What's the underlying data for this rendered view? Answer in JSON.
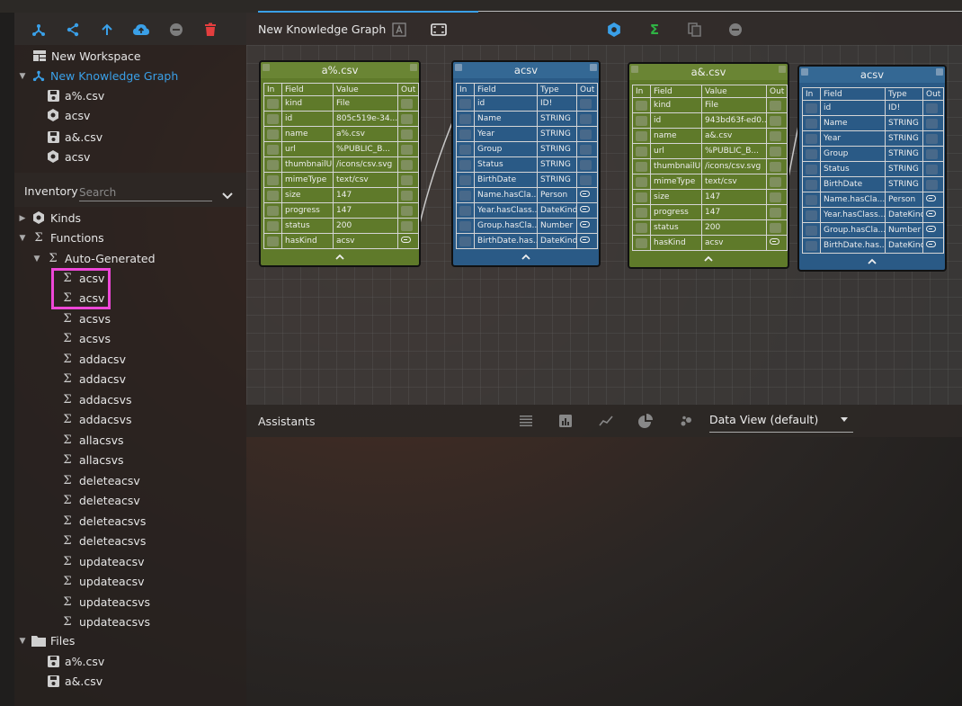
{
  "window": {
    "title": "New Knowledge Graph"
  },
  "colors": {
    "accent": "#3aa0e8",
    "highlight": "#ee47d8",
    "danger": "#e33e3e",
    "green": "#2fb344",
    "node_green": "#5f7a2a",
    "node_blue": "#2a5a86"
  },
  "toolbar": {
    "icons": [
      "graph-icon",
      "share-icon",
      "upload-arrow-icon",
      "cloud-upload-icon",
      "minus-circle-icon",
      "trash-icon"
    ]
  },
  "workspace": {
    "label": "New Workspace",
    "graph": {
      "label": "New Knowledge Graph",
      "children": [
        "a%.csv",
        "acsv",
        "a&.csv",
        "acsv"
      ]
    }
  },
  "inventory": {
    "label": "Inventory",
    "search_placeholder": "Search",
    "kinds_label": "Kinds",
    "functions_label": "Functions",
    "auto_generated_label": "Auto-Generated",
    "functions": [
      "acsv",
      "acsv",
      "acsvs",
      "acsvs",
      "addacsv",
      "addacsv",
      "addacsvs",
      "addacsvs",
      "allacsvs",
      "allacsvs",
      "deleteacsv",
      "deleteacsv",
      "deleteacsvs",
      "deleteacsvs",
      "updateacsv",
      "updateacsv",
      "updateacsvs",
      "updateacsvs"
    ],
    "files_label": "Files",
    "files": [
      "a%.csv",
      "a&.csv"
    ]
  },
  "main": {
    "title": "New Knowledge Graph",
    "toolbar_icons": [
      "text-frame-icon",
      "fit-screen-icon",
      "kind-icon",
      "sigma-icon",
      "copy-icon",
      "minus-circle-icon"
    ]
  },
  "nodes": [
    {
      "title": "a%.csv",
      "headers": [
        "In",
        "Field",
        "Value",
        "Out"
      ],
      "rows": [
        [
          "kind",
          "File"
        ],
        [
          "id",
          "805c519e-34..."
        ],
        [
          "name",
          "a%.csv"
        ],
        [
          "url",
          "%PUBLIC_B..."
        ],
        [
          "thumbnailUrl",
          "/icons/csv.svg"
        ],
        [
          "mimeType",
          "text/csv"
        ],
        [
          "size",
          "147"
        ],
        [
          "progress",
          "147"
        ],
        [
          "status",
          "200"
        ],
        [
          "hasKind",
          "acsv"
        ]
      ]
    },
    {
      "title": "acsv",
      "headers": [
        "In",
        "Field",
        "Type",
        "Out"
      ],
      "rows": [
        [
          "id",
          "ID!"
        ],
        [
          "Name",
          "STRING"
        ],
        [
          "Year",
          "STRING"
        ],
        [
          "Group",
          "STRING"
        ],
        [
          "Status",
          "STRING"
        ],
        [
          "BirthDate",
          "STRING"
        ],
        [
          "Name.hasCla...",
          "Person"
        ],
        [
          "Year.hasClass...",
          "DateKind"
        ],
        [
          "Group.hasCla...",
          "Number"
        ],
        [
          "BirthDate.has...",
          "DateKind"
        ]
      ]
    },
    {
      "title": "a&.csv",
      "headers": [
        "In",
        "Field",
        "Value",
        "Out"
      ],
      "rows": [
        [
          "kind",
          "File"
        ],
        [
          "id",
          "943bd63f-ed0..."
        ],
        [
          "name",
          "a&.csv"
        ],
        [
          "url",
          "%PUBLIC_B..."
        ],
        [
          "thumbnailUrl",
          "/icons/csv.svg"
        ],
        [
          "mimeType",
          "text/csv"
        ],
        [
          "size",
          "147"
        ],
        [
          "progress",
          "147"
        ],
        [
          "status",
          "200"
        ],
        [
          "hasKind",
          "acsv"
        ]
      ]
    },
    {
      "title": "acsv",
      "headers": [
        "In",
        "Field",
        "Type",
        "Out"
      ],
      "rows": [
        [
          "id",
          "ID!"
        ],
        [
          "Name",
          "STRING"
        ],
        [
          "Year",
          "STRING"
        ],
        [
          "Group",
          "STRING"
        ],
        [
          "Status",
          "STRING"
        ],
        [
          "BirthDate",
          "STRING"
        ],
        [
          "Name.hasCla...",
          "Person"
        ],
        [
          "Year.hasClass...",
          "DateKind"
        ],
        [
          "Group.hasCla...",
          "Number"
        ],
        [
          "BirthDate.has...",
          "DateKind"
        ]
      ]
    }
  ],
  "assistants": {
    "label": "Assistants",
    "icons": [
      "list-icon",
      "bar-chart-icon",
      "line-chart-icon",
      "pie-chart-icon",
      "scatter-icon"
    ],
    "view_select": "Data View (default)"
  }
}
